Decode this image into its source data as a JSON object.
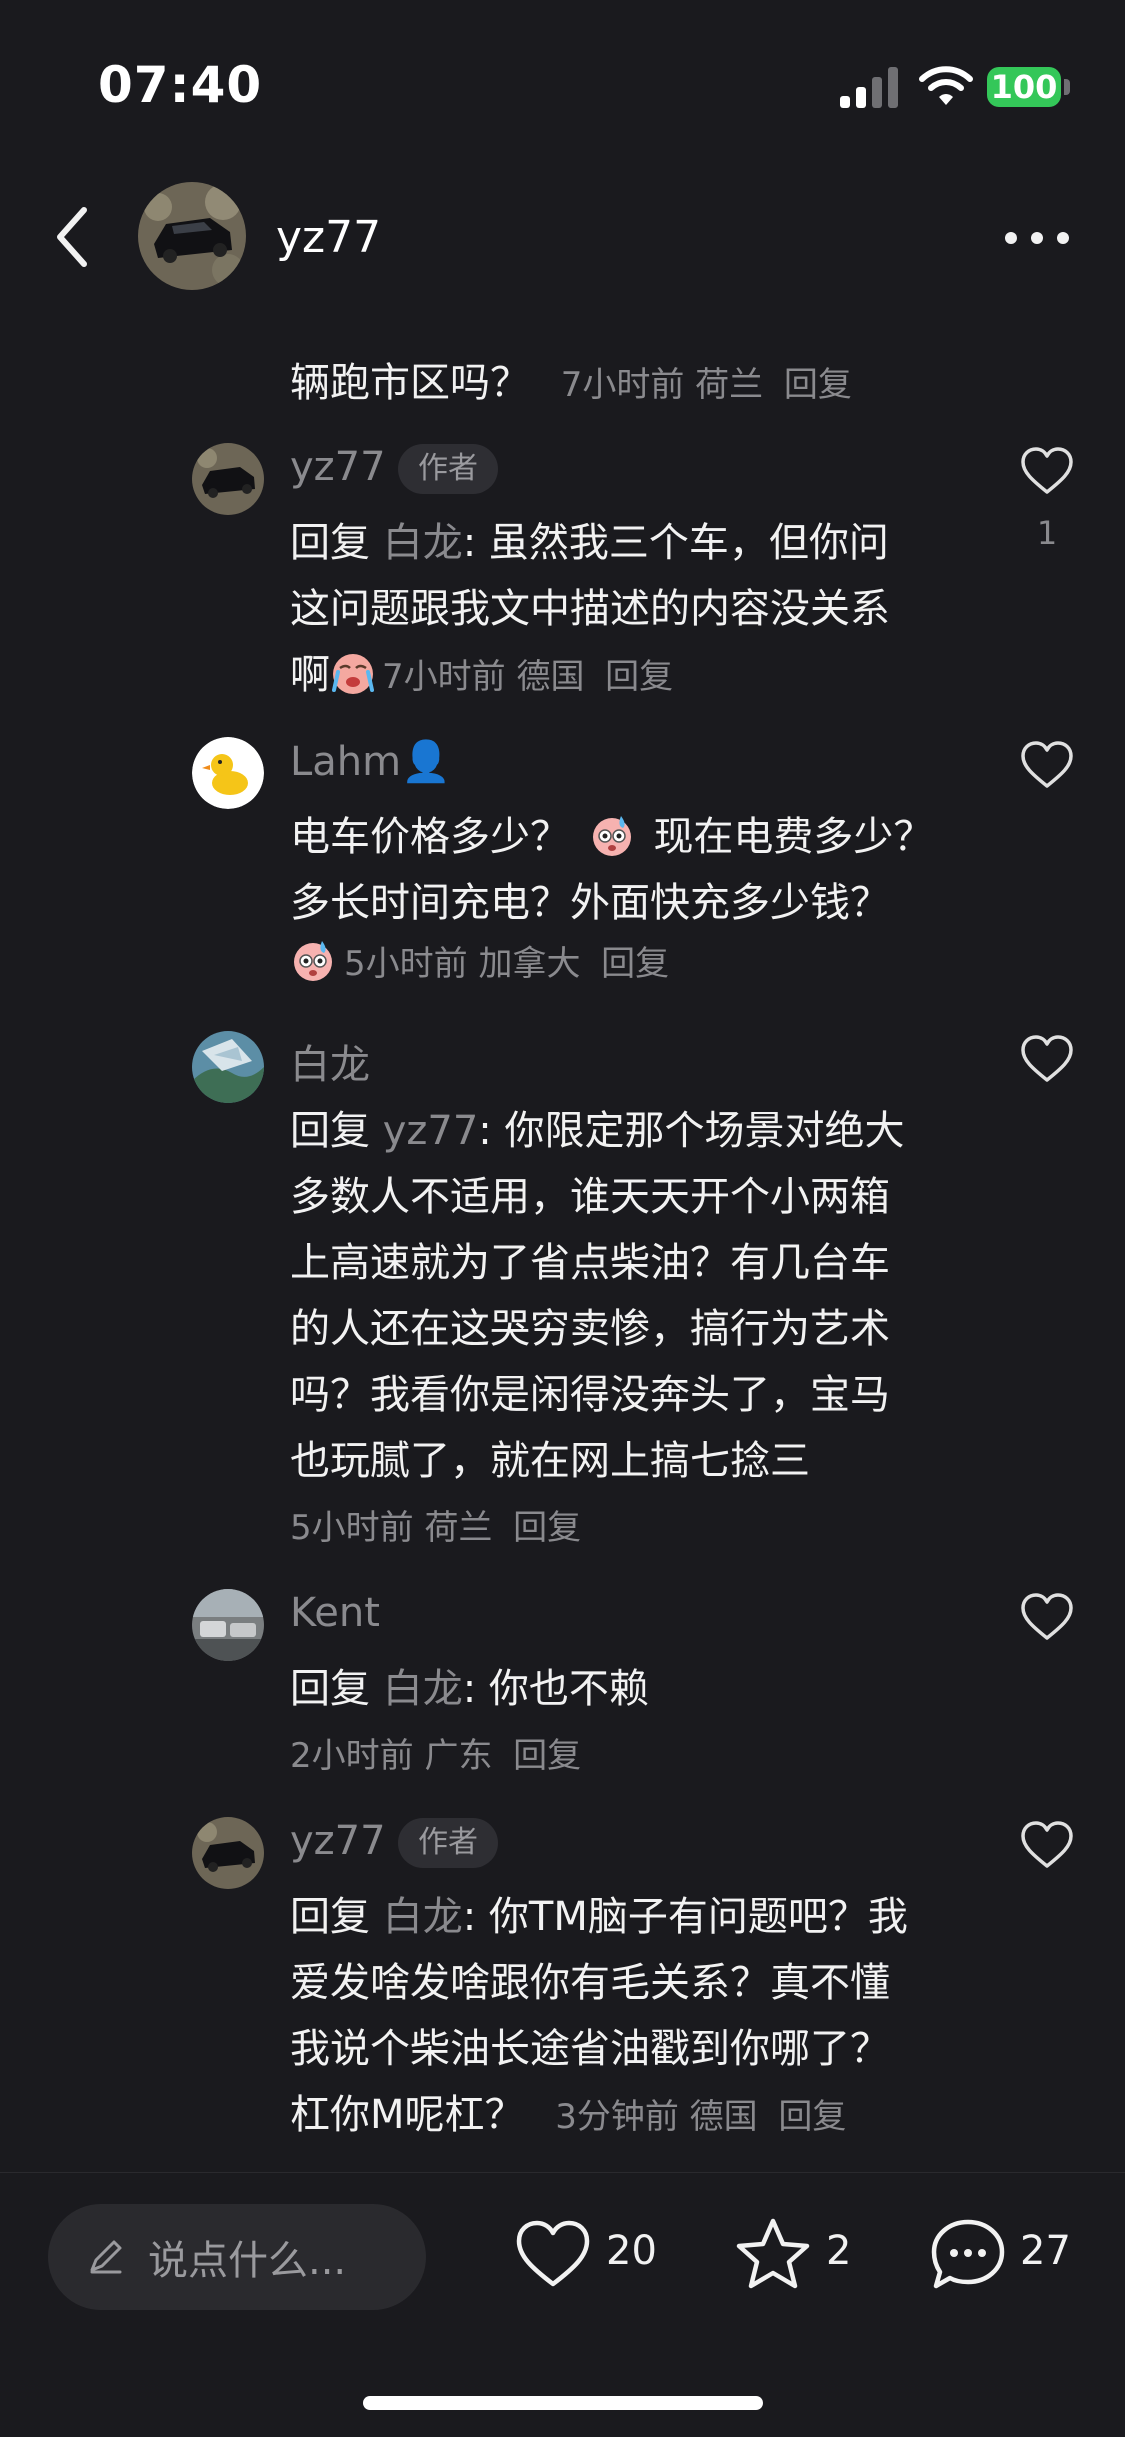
{
  "status_bar": {
    "time": "07:40",
    "battery": "100",
    "icons": [
      "signal-icon",
      "wifi-icon",
      "battery-icon"
    ]
  },
  "nav": {
    "title": "yz77",
    "back_icon": "chevron-left-icon",
    "more_icon": "more-horizontal-icon"
  },
  "author_tag": "作者",
  "comments": [
    {
      "partial": true,
      "lines": [
        {
          "text": "辆跑市区吗？",
          "meta": "7小时前 荷兰",
          "reply": "回复"
        }
      ]
    },
    {
      "user": "yz77",
      "is_author": true,
      "likes": "1",
      "mention": "白龙",
      "reply_prefix": "回复 ",
      "lines": [
        {
          "text": ": 虽然我三个车，但你问"
        },
        {
          "text": "这问题跟我文中描述的内容没关系"
        },
        {
          "text": "啊",
          "emoji": "crying-face-emoji",
          "meta": "7小时前 德国",
          "reply": "回复"
        }
      ]
    },
    {
      "user": "Lahm👤",
      "lines": [
        {
          "text_a": "电车价格多少？",
          "emoji": "sweat-face-emoji",
          "text_b": "现在电费多少？"
        },
        {
          "text": "多长时间充电？外面快充多少钱？"
        },
        {
          "emoji": "sweat-face-emoji",
          "meta": "5小时前 加拿大",
          "reply": "回复"
        }
      ]
    },
    {
      "user": "白龙",
      "mention": "yz77",
      "reply_prefix": "回复 ",
      "lines": [
        {
          "text": ": 你限定那个场景对绝大"
        },
        {
          "text": "多数人不适用，谁天天开个小两箱"
        },
        {
          "text": "上高速就为了省点柴油？有几台车"
        },
        {
          "text": "的人还在这哭穷卖惨，搞行为艺术"
        },
        {
          "text": "吗？我看你是闲得没奔头了，宝马"
        },
        {
          "text": "也玩腻了，就在网上搞七捻三"
        },
        {
          "meta": "5小时前 荷兰",
          "reply": "回复"
        }
      ]
    },
    {
      "user": "Kent",
      "mention": "白龙",
      "reply_prefix": "回复 ",
      "lines": [
        {
          "text": ": 你也不赖"
        },
        {
          "meta": "2小时前 广东",
          "reply": "回复"
        }
      ]
    },
    {
      "user": "yz77",
      "is_author": true,
      "mention": "白龙",
      "reply_prefix": "回复 ",
      "lines": [
        {
          "text": ": 你TM脑子有问题吧？我"
        },
        {
          "text": "爱发啥发啥跟你有毛关系？真不懂"
        },
        {
          "text": "我说个柴油长途省油戳到你哪了？"
        },
        {
          "text": "杠你M呢杠？",
          "meta": "3分钟前 德国",
          "reply": "回复"
        }
      ]
    }
  ],
  "bottom": {
    "input_placeholder": "说点什么...",
    "likes": "20",
    "favorites": "2",
    "comments": "27",
    "icons": [
      "pencil-icon",
      "heart-outline-icon",
      "star-outline-icon",
      "chat-bubble-icon"
    ]
  },
  "colors": {
    "background": "#1a1a1e",
    "text": "#f2f2f2",
    "muted": "#8a8a8e",
    "battery": "#34c759"
  }
}
